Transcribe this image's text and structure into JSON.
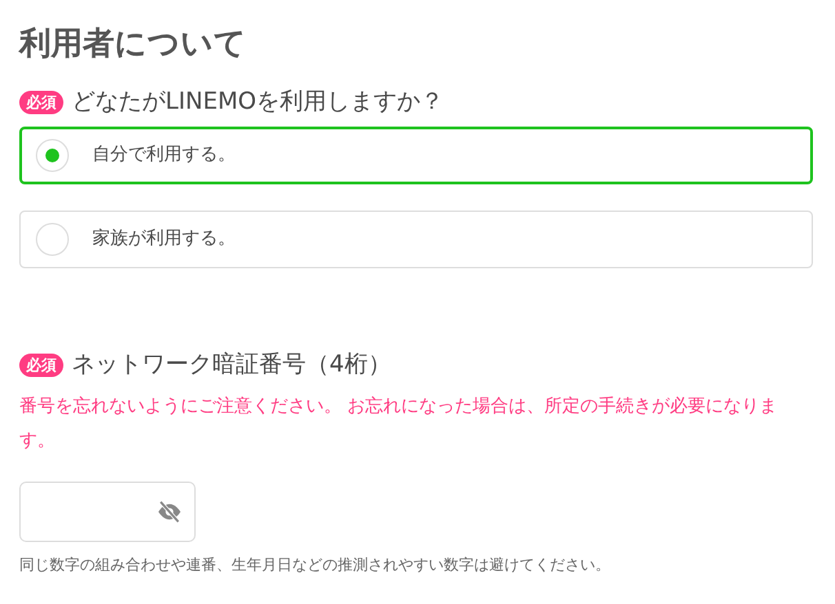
{
  "section_title": "利用者について",
  "user_question": {
    "badge": "必須",
    "label": "どなたがLINEMOを利用しますか？",
    "options": [
      {
        "label": "自分で利用する。",
        "selected": true
      },
      {
        "label": "家族が利用する。",
        "selected": false
      }
    ]
  },
  "pin_question": {
    "badge": "必須",
    "label": "ネットワーク暗証番号（4桁）",
    "notice": "番号を忘れないようにご注意ください。 お忘れになった場合は、所定の手続きが必要になります。",
    "hint": "同じ数字の組み合わせや連番、生年月日などの推測されやすい数字は避けてください。"
  }
}
